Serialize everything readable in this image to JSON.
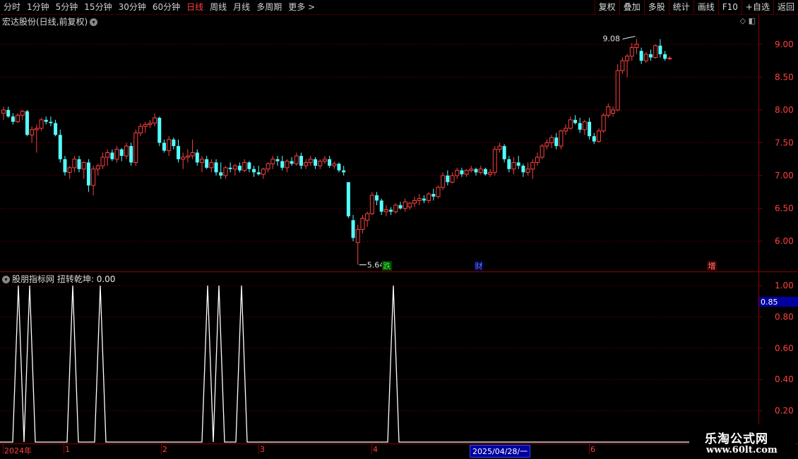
{
  "periods": [
    {
      "label": "分时",
      "active": false
    },
    {
      "label": "1分钟",
      "active": false
    },
    {
      "label": "5分钟",
      "active": false
    },
    {
      "label": "15分钟",
      "active": false
    },
    {
      "label": "30分钟",
      "active": false
    },
    {
      "label": "60分钟",
      "active": false
    },
    {
      "label": "日线",
      "active": true
    },
    {
      "label": "周线",
      "active": false
    },
    {
      "label": "月线",
      "active": false
    },
    {
      "label": "多周期",
      "active": false
    },
    {
      "label": "更多 >",
      "active": false
    }
  ],
  "tools": [
    "复权",
    "叠加",
    "多股",
    "统计",
    "画线",
    "F10",
    "+自选",
    "返回"
  ],
  "stock_title": "宏达股份(日线,前复权)",
  "main_axis": {
    "ticks": [
      "9.00",
      "8.50",
      "8.00",
      "7.50",
      "7.00",
      "6.50",
      "6.00"
    ],
    "min": 5.55,
    "max": 9.45
  },
  "price_annotations": {
    "high": "9.08",
    "low": "5.64"
  },
  "event_markers": [
    {
      "label": "跌",
      "color": "#40ff40",
      "bg": "#004000"
    },
    {
      "label": "财",
      "color": "#6080ff",
      "bg": "#000040"
    },
    {
      "label": "增",
      "color": "#ff8080",
      "bg": "#400000"
    }
  ],
  "sub_title": {
    "name": "股朋指标网",
    "indicator": "扭转乾坤:",
    "value": "0.00"
  },
  "sub_axis": {
    "ticks": [
      "1.00",
      "0.80",
      "0.60",
      "0.40",
      "0.20"
    ],
    "cursor_value": "0.85"
  },
  "dates": {
    "labels": [
      "2024年",
      "1",
      "2",
      "3",
      "4",
      "6"
    ],
    "cursor": "2025/04/28/一"
  },
  "watermark": {
    "line1": "乐淘公式网",
    "line2": "www.60lt.com"
  },
  "colors": {
    "up": "#ff4040",
    "down": "#54ffff",
    "grid": "#8b0000",
    "line": "#ffffff"
  },
  "chart_data": {
    "type": "candlestick",
    "candles": [
      [
        7.95,
        8.05,
        7.85,
        8.0
      ],
      [
        8.0,
        8.05,
        7.88,
        7.9
      ],
      [
        7.9,
        7.95,
        7.78,
        7.82
      ],
      [
        7.82,
        7.95,
        7.8,
        7.92
      ],
      [
        7.92,
        8.0,
        7.85,
        7.98
      ],
      [
        7.98,
        8.0,
        7.6,
        7.62
      ],
      [
        7.62,
        7.75,
        7.5,
        7.7
      ],
      [
        7.7,
        7.78,
        7.35,
        7.72
      ],
      [
        7.72,
        7.88,
        7.68,
        7.85
      ],
      [
        7.85,
        7.9,
        7.78,
        7.82
      ],
      [
        7.82,
        7.9,
        7.75,
        7.8
      ],
      [
        7.8,
        7.85,
        7.6,
        7.62
      ],
      [
        7.62,
        7.7,
        7.2,
        7.25
      ],
      [
        7.25,
        7.3,
        7.0,
        7.05
      ],
      [
        7.05,
        7.15,
        6.95,
        7.12
      ],
      [
        7.12,
        7.3,
        7.05,
        7.25
      ],
      [
        7.25,
        7.3,
        7.05,
        7.1
      ],
      [
        7.1,
        7.22,
        6.95,
        7.2
      ],
      [
        7.2,
        7.25,
        6.75,
        6.85
      ],
      [
        6.85,
        7.15,
        6.7,
        7.1
      ],
      [
        7.1,
        7.18,
        7.0,
        7.15
      ],
      [
        7.15,
        7.35,
        7.1,
        7.28
      ],
      [
        7.28,
        7.4,
        7.15,
        7.35
      ],
      [
        7.35,
        7.4,
        7.22,
        7.25
      ],
      [
        7.25,
        7.45,
        7.2,
        7.4
      ],
      [
        7.4,
        7.42,
        7.22,
        7.3
      ],
      [
        7.3,
        7.5,
        7.25,
        7.45
      ],
      [
        7.45,
        7.5,
        7.15,
        7.2
      ],
      [
        7.2,
        7.7,
        7.15,
        7.65
      ],
      [
        7.65,
        7.8,
        7.6,
        7.75
      ],
      [
        7.75,
        7.82,
        7.65,
        7.78
      ],
      [
        7.78,
        7.85,
        7.72,
        7.8
      ],
      [
        7.8,
        7.95,
        7.75,
        7.88
      ],
      [
        7.88,
        7.9,
        7.45,
        7.5
      ],
      [
        7.5,
        7.55,
        7.35,
        7.38
      ],
      [
        7.38,
        7.6,
        7.3,
        7.55
      ],
      [
        7.55,
        7.58,
        7.4,
        7.45
      ],
      [
        7.45,
        7.55,
        7.2,
        7.25
      ],
      [
        7.25,
        7.35,
        7.1,
        7.28
      ],
      [
        7.28,
        7.4,
        7.2,
        7.3
      ],
      [
        7.3,
        7.55,
        7.25,
        7.35
      ],
      [
        7.35,
        7.4,
        7.15,
        7.2
      ],
      [
        7.2,
        7.3,
        7.05,
        7.25
      ],
      [
        7.25,
        7.3,
        7.1,
        7.12
      ],
      [
        7.12,
        7.25,
        7.05,
        7.2
      ],
      [
        7.2,
        7.25,
        7.0,
        7.05
      ],
      [
        7.05,
        7.2,
        6.95,
        7.0
      ],
      [
        7.0,
        7.15,
        6.95,
        7.12
      ],
      [
        7.12,
        7.2,
        7.05,
        7.1
      ],
      [
        7.1,
        7.18,
        7.0,
        7.15
      ],
      [
        7.15,
        7.2,
        7.05,
        7.08
      ],
      [
        7.08,
        7.25,
        7.05,
        7.2
      ],
      [
        7.2,
        7.22,
        7.05,
        7.1
      ],
      [
        7.1,
        7.15,
        6.98,
        7.05
      ],
      [
        7.05,
        7.15,
        7.0,
        7.02
      ],
      [
        7.02,
        7.12,
        6.95,
        7.1
      ],
      [
        7.1,
        7.2,
        7.05,
        7.18
      ],
      [
        7.18,
        7.3,
        7.1,
        7.25
      ],
      [
        7.25,
        7.3,
        7.15,
        7.22
      ],
      [
        7.22,
        7.3,
        7.08,
        7.12
      ],
      [
        7.12,
        7.25,
        7.05,
        7.22
      ],
      [
        7.22,
        7.28,
        7.15,
        7.18
      ],
      [
        7.18,
        7.35,
        7.15,
        7.3
      ],
      [
        7.3,
        7.35,
        7.1,
        7.15
      ],
      [
        7.15,
        7.25,
        7.1,
        7.2
      ],
      [
        7.2,
        7.3,
        7.15,
        7.25
      ],
      [
        7.25,
        7.28,
        7.1,
        7.15
      ],
      [
        7.15,
        7.25,
        7.1,
        7.22
      ],
      [
        7.22,
        7.3,
        7.18,
        7.25
      ],
      [
        7.25,
        7.3,
        7.12,
        7.15
      ],
      [
        7.15,
        7.22,
        7.1,
        7.18
      ],
      [
        7.18,
        7.2,
        7.05,
        7.08
      ],
      [
        7.08,
        7.15,
        7.0,
        7.05
      ],
      [
        6.9,
        6.9,
        6.35,
        6.38
      ],
      [
        6.32,
        6.4,
        6.0,
        6.05
      ],
      [
        5.98,
        6.25,
        5.64,
        6.18
      ],
      [
        6.18,
        6.4,
        6.12,
        6.35
      ],
      [
        6.32,
        6.45,
        6.22,
        6.42
      ],
      [
        6.42,
        6.75,
        6.4,
        6.7
      ],
      [
        6.7,
        6.75,
        6.55,
        6.62
      ],
      [
        6.62,
        6.65,
        6.4,
        6.45
      ],
      [
        6.45,
        6.55,
        6.38,
        6.48
      ],
      [
        6.48,
        6.52,
        6.4,
        6.45
      ],
      [
        6.45,
        6.58,
        6.42,
        6.55
      ],
      [
        6.55,
        6.6,
        6.48,
        6.5
      ],
      [
        6.5,
        6.65,
        6.45,
        6.6
      ],
      [
        6.52,
        6.6,
        6.48,
        6.58
      ],
      [
        6.58,
        6.68,
        6.52,
        6.62
      ],
      [
        6.62,
        6.72,
        6.55,
        6.65
      ],
      [
        6.65,
        6.7,
        6.58,
        6.62
      ],
      [
        6.62,
        6.75,
        6.58,
        6.72
      ],
      [
        6.72,
        6.8,
        6.62,
        6.68
      ],
      [
        6.68,
        6.85,
        6.65,
        6.82
      ],
      [
        6.82,
        7.05,
        6.78,
        7.0
      ],
      [
        7.0,
        7.08,
        6.85,
        6.9
      ],
      [
        6.9,
        7.05,
        6.88,
        7.0
      ],
      [
        7.0,
        7.12,
        6.95,
        7.08
      ],
      [
        7.08,
        7.12,
        6.98,
        7.02
      ],
      [
        7.02,
        7.1,
        6.98,
        7.08
      ],
      [
        7.08,
        7.15,
        7.05,
        7.1
      ],
      [
        7.1,
        7.12,
        7.0,
        7.05
      ],
      [
        7.05,
        7.15,
        7.02,
        7.1
      ],
      [
        7.1,
        7.12,
        7.0,
        7.02
      ],
      [
        7.02,
        7.1,
        6.98,
        7.05
      ],
      [
        7.05,
        7.45,
        7.0,
        7.4
      ],
      [
        7.4,
        7.5,
        7.35,
        7.45
      ],
      [
        7.45,
        7.48,
        7.2,
        7.25
      ],
      [
        7.25,
        7.3,
        7.05,
        7.1
      ],
      [
        7.1,
        7.28,
        7.02,
        7.2
      ],
      [
        7.2,
        7.3,
        7.1,
        7.15
      ],
      [
        7.15,
        7.18,
        6.98,
        7.05
      ],
      [
        7.05,
        7.2,
        7.0,
        7.1
      ],
      [
        7.1,
        7.25,
        6.95,
        7.2
      ],
      [
        7.2,
        7.35,
        7.15,
        7.28
      ],
      [
        7.28,
        7.48,
        7.25,
        7.45
      ],
      [
        7.45,
        7.55,
        7.4,
        7.5
      ],
      [
        7.5,
        7.62,
        7.42,
        7.58
      ],
      [
        7.58,
        7.65,
        7.4,
        7.45
      ],
      [
        7.45,
        7.7,
        7.4,
        7.68
      ],
      [
        7.68,
        7.78,
        7.62,
        7.72
      ],
      [
        7.72,
        7.9,
        7.7,
        7.85
      ],
      [
        7.85,
        7.92,
        7.78,
        7.8
      ],
      [
        7.8,
        7.88,
        7.65,
        7.7
      ],
      [
        7.7,
        7.85,
        7.62,
        7.82
      ],
      [
        7.82,
        7.88,
        7.55,
        7.6
      ],
      [
        7.6,
        7.65,
        7.48,
        7.52
      ],
      [
        7.52,
        7.72,
        7.5,
        7.68
      ],
      [
        7.68,
        7.95,
        7.65,
        7.92
      ],
      [
        7.92,
        8.1,
        7.88,
        8.05
      ],
      [
        7.95,
        8.05,
        7.9,
        8.0
      ],
      [
        8.0,
        8.7,
        7.98,
        8.6
      ],
      [
        8.6,
        8.8,
        8.55,
        8.75
      ],
      [
        8.75,
        8.85,
        8.5,
        8.82
      ],
      [
        8.82,
        9.02,
        8.75,
        8.95
      ],
      [
        8.95,
        9.08,
        8.85,
        9.0
      ],
      [
        8.9,
        8.95,
        8.7,
        8.75
      ],
      [
        8.75,
        8.88,
        8.72,
        8.85
      ],
      [
        8.85,
        8.92,
        8.75,
        8.8
      ],
      [
        8.8,
        9.0,
        8.78,
        8.98
      ],
      [
        8.98,
        9.08,
        8.8,
        8.85
      ],
      [
        8.85,
        8.9,
        8.75,
        8.78
      ],
      [
        8.78,
        8.82,
        8.76,
        8.79
      ]
    ]
  },
  "indicator_data": {
    "spikes": [
      26,
      42,
      103,
      142,
      294,
      310,
      342,
      557
    ]
  }
}
